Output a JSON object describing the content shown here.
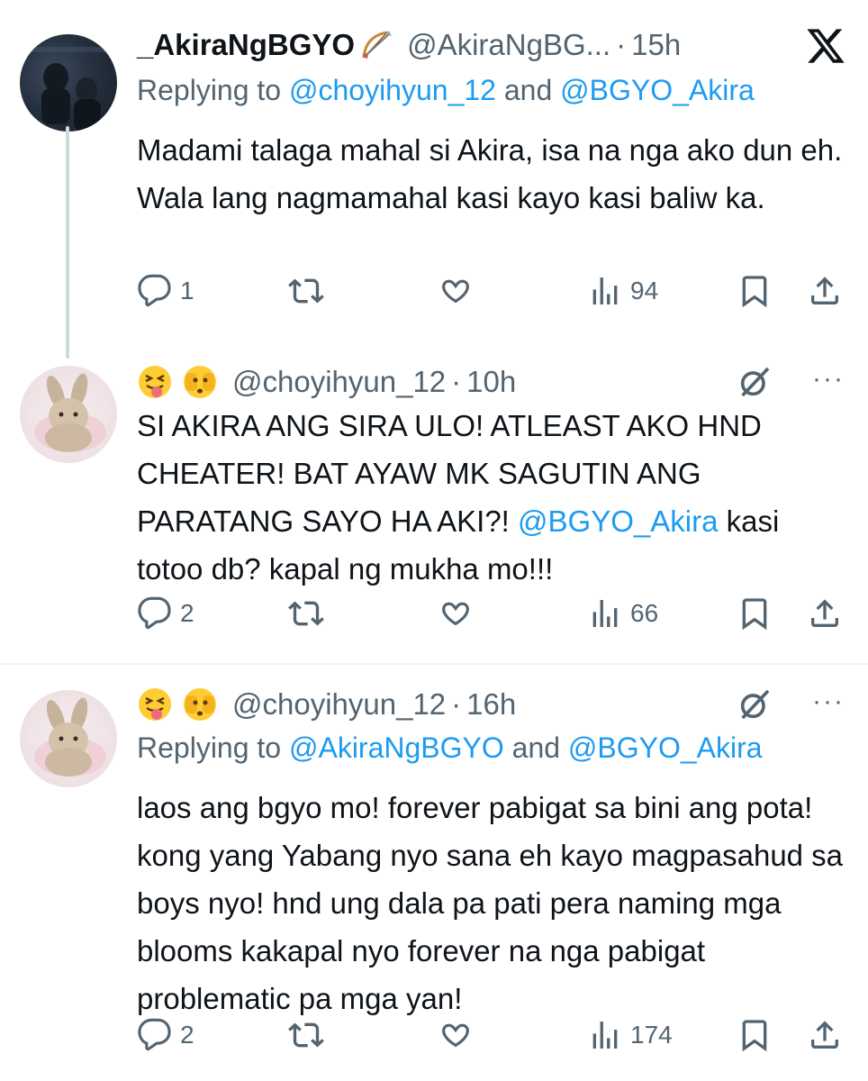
{
  "tweets": [
    {
      "display_name": "_AkiraNgBGYO",
      "handle": "@AkiraNgBG...",
      "time": "15h",
      "dot": "·",
      "reply_prefix": "Replying to ",
      "reply_mention_1": "@choyihyun_12",
      "reply_and": " and ",
      "reply_mention_2": "@BGYO_Akira",
      "text": "Madami talaga mahal si Akira, isa na nga ako dun eh. Wala lang nagmamahal kasi kayo kasi baliw ka.",
      "replies": "1",
      "views": "94"
    },
    {
      "handle": "@choyihyun_12",
      "time": "10h",
      "dot": "·",
      "text_part1": "SI AKIRA ANG SIRA ULO! ATLEAST AKO HND CHEATER! BAT AYAW MK SAGUTIN ANG PARATANG SAYO HA AKI?! ",
      "text_mention": "@BGYO_Akira",
      "text_part2": " kasi totoo db? kapal ng mukha mo!!!",
      "replies": "2",
      "views": "66",
      "more": "···"
    },
    {
      "handle": "@choyihyun_12",
      "time": "16h",
      "dot": "·",
      "reply_prefix": "Replying to ",
      "reply_mention_1": "@AkiraNgBGYO",
      "reply_and": " and ",
      "reply_mention_2": "@BGYO_Akira",
      "text": "laos ang bgyo mo! forever pabigat sa bini ang pota! kong yang Yabang nyo sana eh kayo magpasahud sa boys nyo! hnd ung dala pa pati pera naming mga blooms kakapal nyo forever na nga pabigat problematic pa mga yan!",
      "replies": "2",
      "views": "174",
      "more": "···"
    }
  ],
  "colors": {
    "text": "#0f1419",
    "secondary": "#536471",
    "link": "#1d9bf0",
    "divider": "#eff3f4",
    "thread_line": "#cfd9de"
  },
  "icons": [
    "x-logo-icon",
    "reply-icon",
    "retweet-icon",
    "like-icon",
    "views-icon",
    "bookmark-icon",
    "share-icon",
    "grok-icon",
    "more-icon",
    "bow-arrow-emoji",
    "tongue-emoji",
    "peeking-emoji"
  ]
}
